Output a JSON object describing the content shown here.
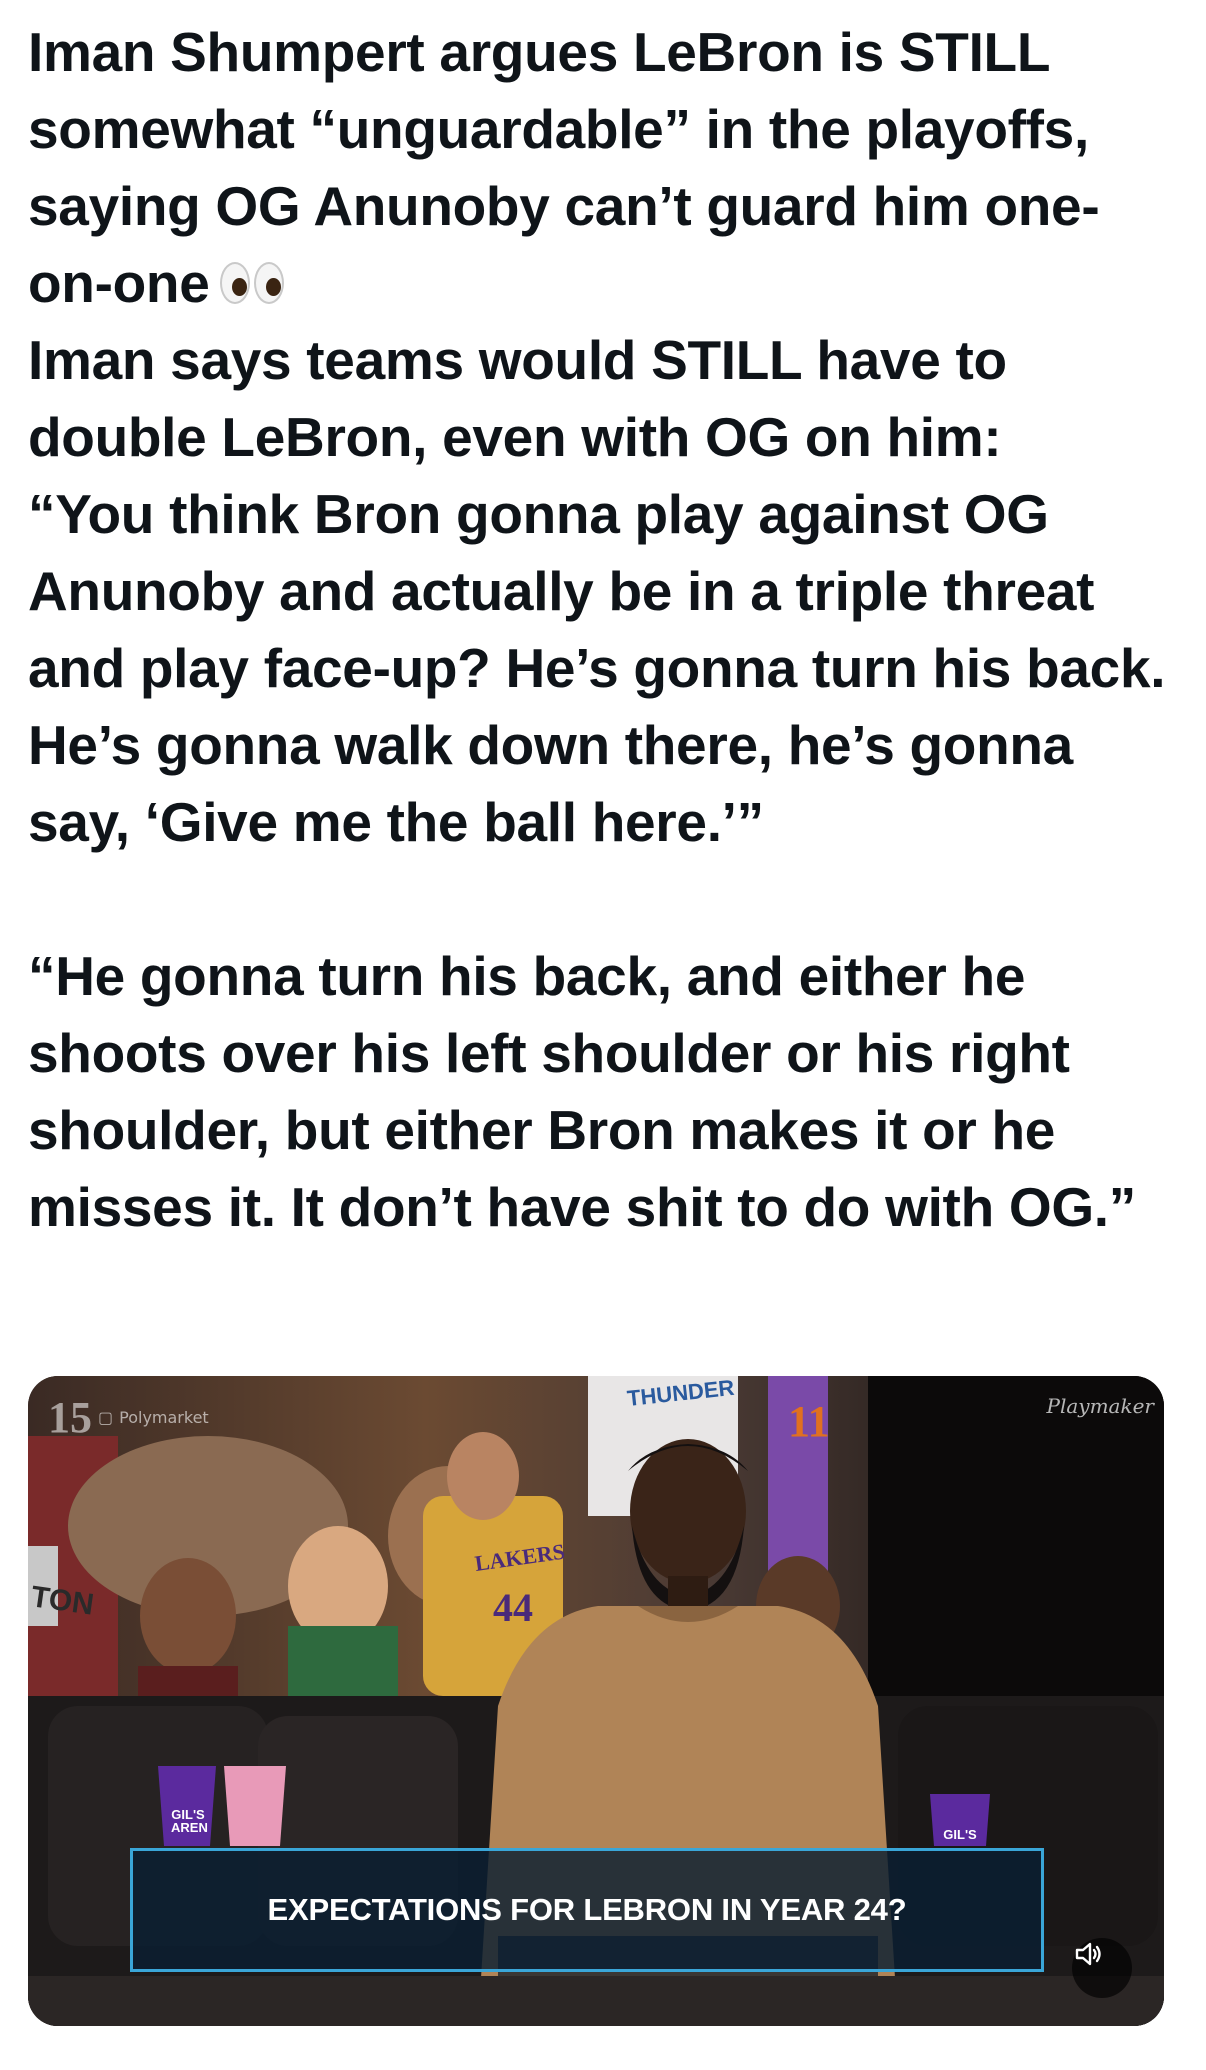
{
  "tweet": {
    "paragraph1": "Iman Shumpert argues LeBron is STILL somewhat “unguardable” in the playoffs, saying OG Anunoby can’t guard him one-on-one",
    "emoji_icon": "eyes-emoji",
    "paragraph2": "Iman says teams would STILL have to double LeBron, even with OG on him:",
    "quote1": "“You think Bron gonna play against OG Anunoby and actually be in a triple threat and play face-up? He’s gonna turn his back. He’s gonna walk down there, he’s gonna say, ‘Give me the ball here.’”",
    "quote2": "“He gonna turn his back, and either he shoots over his left shoulder or his right shoulder, but either Bron makes it or he misses it. It don’t have shit to do with OG.”"
  },
  "media": {
    "watermark_number": "15",
    "watermark_brand": "Polymarket",
    "watermark_right": "Playmaker",
    "banner_text": "EXPECTATIONS FOR LEBRON IN YEAR 24?",
    "cup_left_label": "GIL'S AREN",
    "cup_right_label": "GIL'S",
    "jersey_lakers": "LAKERS",
    "jersey_number": "44",
    "jersey_left": "TON",
    "jersey_top": "THUNDER",
    "jersey_top_number": "11",
    "sound_icon": "speaker-icon",
    "colors": {
      "banner_border": "#3aa6d8",
      "shirt": "#b08457",
      "cup_pink": "#e89ab8",
      "cup_purple": "#5b2a9e"
    }
  }
}
